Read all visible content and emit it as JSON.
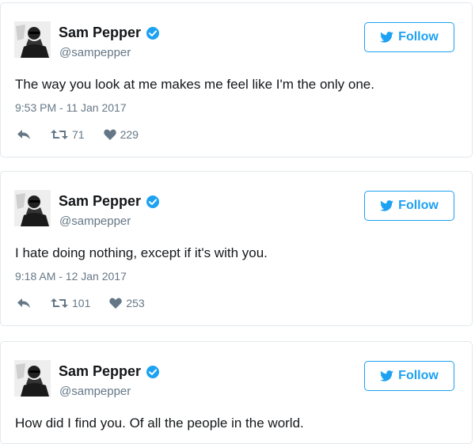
{
  "tweets": [
    {
      "name": "Sam Pepper",
      "handle": "@sampepper",
      "follow_label": "Follow",
      "text": "The way you look at me makes me feel like I'm the only one.",
      "timestamp": "9:53 PM - 11 Jan 2017",
      "retweets": "71",
      "likes": "229"
    },
    {
      "name": "Sam Pepper",
      "handle": "@sampepper",
      "follow_label": "Follow",
      "text": "I hate doing nothing, except if it's with you.",
      "timestamp": "9:18 AM - 12 Jan 2017",
      "retweets": "101",
      "likes": "253"
    },
    {
      "name": "Sam Pepper",
      "handle": "@sampepper",
      "follow_label": "Follow",
      "text": "How did I find you. Of all the people in the world."
    }
  ],
  "icons": {
    "verified": "verified-badge-icon",
    "bird": "twitter-bird-icon",
    "reply": "reply-icon",
    "retweet": "retweet-icon",
    "like": "heart-icon"
  },
  "colors": {
    "accent": "#1da1f2",
    "muted": "#657786",
    "text": "#14171a",
    "border": "#e1e8ed"
  }
}
